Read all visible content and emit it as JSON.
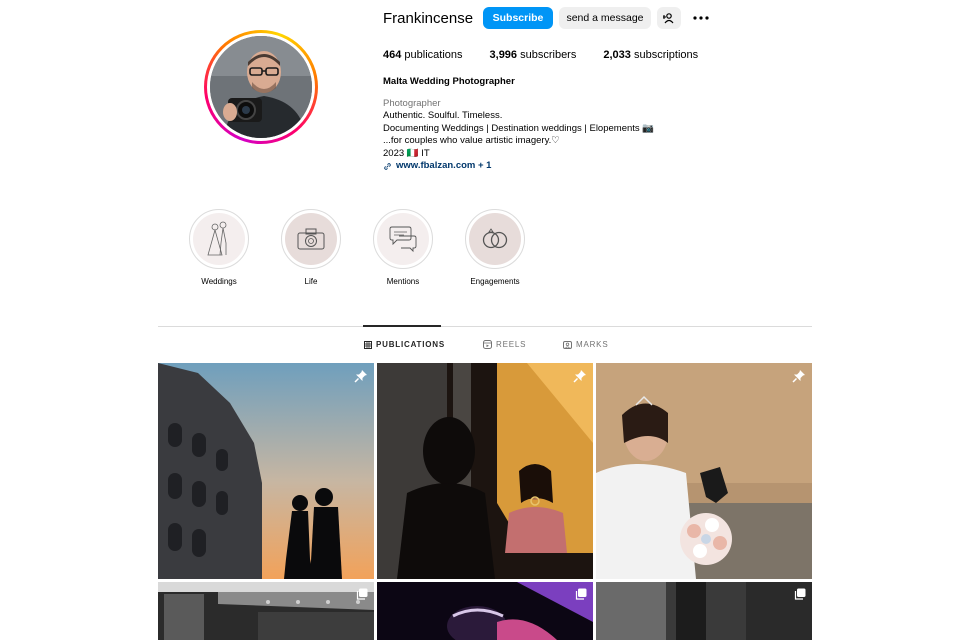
{
  "profile": {
    "username": "Frankincense",
    "subscribe_label": "Subscribe",
    "message_label": "send a message",
    "stats": [
      {
        "value": "464",
        "label": "publications"
      },
      {
        "value": "3,996",
        "label": "subscribers"
      },
      {
        "value": "2,033",
        "label": "subscriptions"
      }
    ],
    "bio": {
      "name": "Malta Wedding Photographer",
      "category": "Photographer",
      "lines": [
        "Authentic. Soulful. Timeless.",
        "Documenting Weddings | Destination weddings | Elopements 📷",
        "...for couples who value artistic imagery.♡",
        "2023 🇮🇹 IT"
      ],
      "link": "www.fbalzan.com + 1"
    }
  },
  "highlights": [
    {
      "label": "Weddings",
      "icon": "bride-groom-sketch-icon"
    },
    {
      "label": "Life",
      "icon": "camera-sketch-icon"
    },
    {
      "label": "Mentions",
      "icon": "speech-bubbles-icon"
    },
    {
      "label": "Engagements",
      "icon": "rings-icon"
    }
  ],
  "tabs": [
    {
      "label": "PUBLICATIONS",
      "icon": "grid-icon",
      "active": true
    },
    {
      "label": "REELS",
      "icon": "reels-icon",
      "active": false
    },
    {
      "label": "MARKS",
      "icon": "tagged-icon",
      "active": false
    }
  ],
  "posts": [
    {
      "subject": "couple silhouette at Colosseum sunset",
      "badge": "pin-icon"
    },
    {
      "subject": "bride in shadow with blurred groom",
      "badge": "pin-icon"
    },
    {
      "subject": "bride with bouquet on cobblestone street",
      "badge": "pin-icon"
    },
    {
      "subject": "black and white venue interior",
      "badge": "carousel-icon"
    },
    {
      "subject": "couple under purple light",
      "badge": "carousel-icon"
    },
    {
      "subject": "black and white doorway",
      "badge": "carousel-icon"
    }
  ]
}
